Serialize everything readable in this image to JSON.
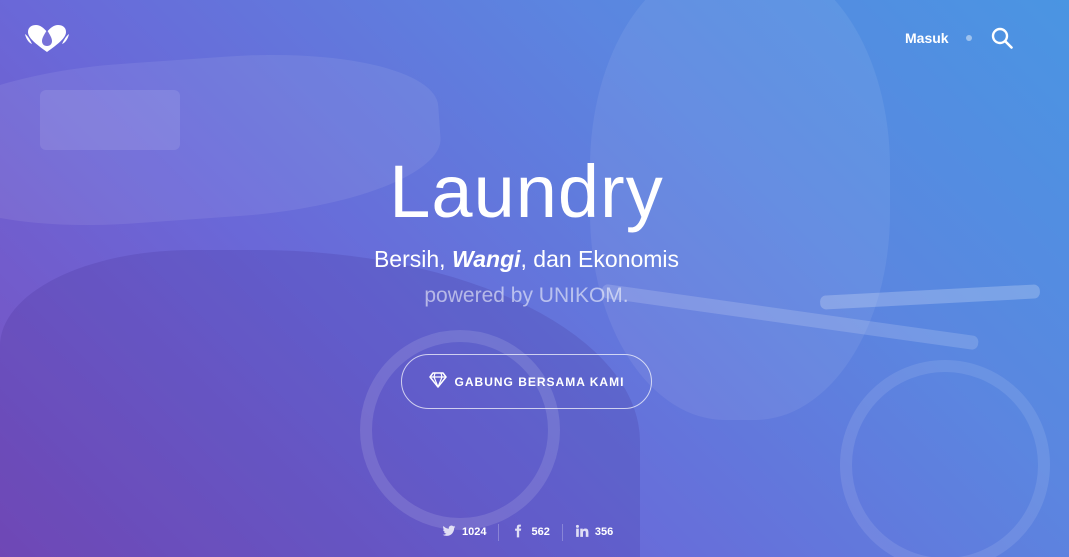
{
  "header": {
    "logo_icon": "heart-drop-logo",
    "login_label": "Masuk",
    "search_icon": "search-icon"
  },
  "hero": {
    "title": "Laundry",
    "subtitle_part1": "Bersih, ",
    "subtitle_emphasis": "Wangi",
    "subtitle_part2": ", dan Ekonomis",
    "powered_by": "powered by UNIKOM.",
    "cta_label": "GABUNG BERSAMA KAMI",
    "cta_icon": "diamond-icon"
  },
  "social": [
    {
      "icon": "twitter-icon",
      "count": "1024"
    },
    {
      "icon": "facebook-icon",
      "count": "562"
    },
    {
      "icon": "linkedin-icon",
      "count": "356"
    }
  ],
  "colors": {
    "gradient_start": "#7a4fbf",
    "gradient_end": "#4a95e2",
    "text": "#ffffff"
  }
}
